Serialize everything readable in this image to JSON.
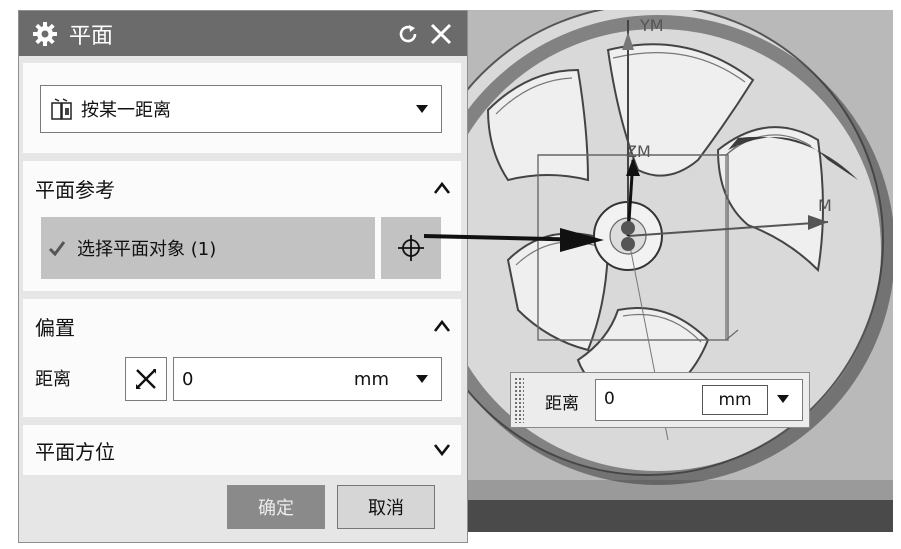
{
  "dialog": {
    "title": "平面",
    "icons": {
      "title": "gear-icon",
      "reset": "reset-icon",
      "close": "close-icon"
    },
    "type_select": {
      "value": "按某一距离",
      "icon": "plane-distance-icon"
    },
    "plane_ref": {
      "title": "平面参考",
      "select_label": "选择平面对象 (1)"
    },
    "offset": {
      "title": "偏置",
      "distance_label": "距离",
      "distance_value": "0",
      "unit": "mm"
    },
    "orientation": {
      "title": "平面方位"
    },
    "ok_label": "确定",
    "cancel_label": "取消"
  },
  "viewport": {
    "axes": {
      "y": "YM",
      "z": "ZM",
      "x": "M"
    },
    "floating": {
      "label": "距离",
      "value": "0",
      "unit": "mm"
    }
  },
  "colors": {
    "titlebar": "#6b6b6b",
    "viewport_bg": "#b9b9b9",
    "ok_button": "#8a8a8a"
  }
}
